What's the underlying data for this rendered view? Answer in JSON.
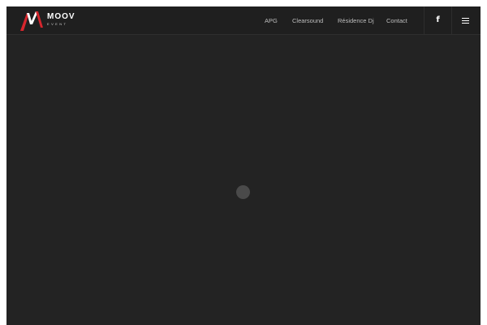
{
  "header": {
    "logo": {
      "wordmark": "MOOV",
      "subtitle": "EVENT",
      "icon": "moov-logo-icon",
      "accent_color": "#d6262d"
    },
    "nav": [
      {
        "label": "APG"
      },
      {
        "label": "Clearsound"
      },
      {
        "label": "Résidence Dj"
      },
      {
        "label": "Contact"
      }
    ],
    "social": {
      "icon": "facebook-icon",
      "glyph": "f"
    },
    "menu": {
      "icon": "hamburger-menu-icon"
    }
  },
  "main": {
    "loader": {
      "icon": "loading-spinner-icon"
    }
  },
  "colors": {
    "page_background": "#232323",
    "header_background": "#1f1f1f",
    "nav_text": "#bdbdbd",
    "loader": "#4a4a4a"
  }
}
